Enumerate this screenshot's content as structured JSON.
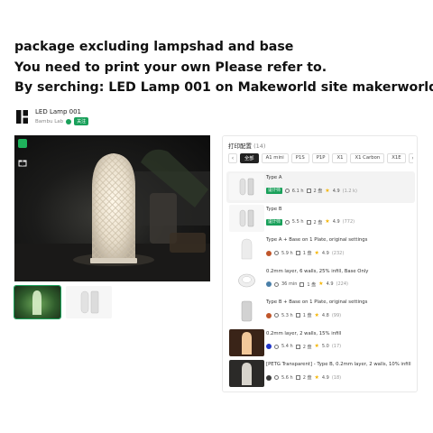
{
  "headline": {
    "line1": "package excluding lampshad and base",
    "line2": "You need to print your own Please refer to.",
    "line3": "By serching: LED Lamp 001 on Makeworld site  makerworld"
  },
  "model": {
    "title": "LED Lamp 001",
    "author": "Bambu Lab",
    "follow_label": "关注"
  },
  "panel": {
    "title": "打印配置",
    "count": "(14)",
    "tabs": [
      "全部",
      "A1 mini",
      "P1S",
      "P1P",
      "X1",
      "X1 Carbon",
      "X1E"
    ],
    "prev_icon": "‹",
    "next_icon": "›"
  },
  "profiles": [
    {
      "name": "Type A",
      "tag": "设计师",
      "time": "6.1 h",
      "plates": "2 盘",
      "rating": "4.9",
      "reviews": "(1.2 k)",
      "thumb": "cylinders-gray",
      "avatar_color": ""
    },
    {
      "name": "Type B",
      "tag": "设计师",
      "time": "5.5 h",
      "plates": "2 盘",
      "rating": "4.9",
      "reviews": "(772)",
      "thumb": "cylinders-gray",
      "avatar_color": ""
    },
    {
      "name": "Type A + Base on 1 Plate, original settings",
      "tag": "",
      "time": "5.9 h",
      "plates": "1 盘",
      "rating": "4.9",
      "reviews": "(232)",
      "thumb": "lamp-white",
      "avatar_color": "#c0562b"
    },
    {
      "name": "0.2mm layer, 6 walls, 25% infill, Base Only",
      "tag": "",
      "time": "36 min",
      "plates": "1 盘",
      "rating": "4.9",
      "reviews": "(224)",
      "thumb": "base-ring",
      "avatar_color": "#4a7fa8"
    },
    {
      "name": "Type B + Base on 1 Plate, original settings",
      "tag": "",
      "time": "5.3 h",
      "plates": "1 盘",
      "rating": "4.8",
      "reviews": "(99)",
      "thumb": "lamp-gray",
      "avatar_color": "#c0562b"
    },
    {
      "name": "0.2mm layer, 2 walls, 15% infill",
      "tag": "",
      "time": "5.4 h",
      "plates": "2 盘",
      "rating": "5.0",
      "reviews": "(17)",
      "thumb": "lamp-glow",
      "avatar_color": "#2035c8"
    },
    {
      "name": "[PETG Transparent] - Type B, 0.2mm layer, 2 walls, 10% infill",
      "tag": "",
      "time": "5.6 h",
      "plates": "2 盘",
      "rating": "4.9",
      "reviews": "(18)",
      "thumb": "lamp-dark",
      "avatar_color": "#3a3a3a"
    }
  ]
}
